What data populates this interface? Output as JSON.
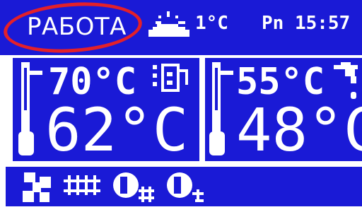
{
  "status": {
    "label": "РАБОТА",
    "ring_color": "#e3202a"
  },
  "header": {
    "weather_icon": "cloud-sun-icon",
    "outside_temp": "1°C",
    "day": "Pn",
    "time": "15:57",
    "clock_text": "Pn 15:57"
  },
  "boiler": {
    "setpoint": "70°C",
    "current": "62°C",
    "icons": [
      "thermometer-icon",
      "boiler-icon"
    ]
  },
  "hot_water": {
    "setpoint": "55°C",
    "current": "48°C",
    "icons": [
      "thermometer-icon",
      "tap-icon"
    ]
  },
  "bottom_icons": [
    "fan-icon",
    "feeder-icon",
    "pump-heating-icon",
    "pump-dhw-icon"
  ],
  "colors": {
    "panel_blue": "#1a1ad6",
    "text": "#ffffff",
    "background": "#ffffff"
  }
}
